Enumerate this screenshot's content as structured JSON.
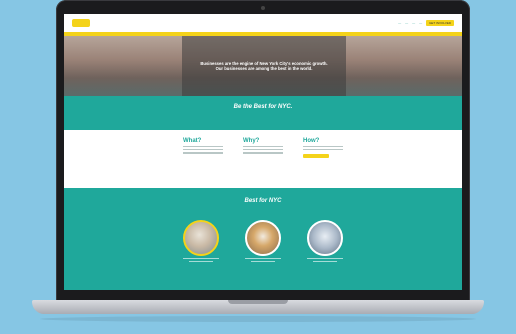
{
  "site": {
    "nav_cta": "GET INVOLVED"
  },
  "hero": {
    "headline": "Businesses are the engine of New York City's economic growth. Our businesses are among the best in the world."
  },
  "banner": {
    "title": "Be the Best for NYC."
  },
  "wwh": {
    "what": "What?",
    "why": "Why?",
    "how": "How?"
  },
  "best": {
    "title": "Best for NYC"
  },
  "colors": {
    "page_bg": "#86c6e4",
    "teal": "#1fa89b",
    "yellow": "#f4d31a"
  },
  "icons": [
    "laptop-icon"
  ]
}
